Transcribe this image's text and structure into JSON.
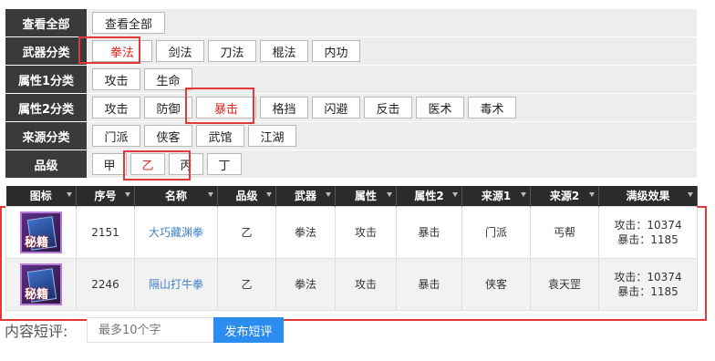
{
  "filters": [
    {
      "label": "查看全部",
      "options": [
        "查看全部"
      ],
      "active": -1
    },
    {
      "label": "武器分类",
      "options": [
        "拳法",
        "剑法",
        "刀法",
        "棍法",
        "内功"
      ],
      "active": 0
    },
    {
      "label": "属性1分类",
      "options": [
        "攻击",
        "生命"
      ],
      "active": -1
    },
    {
      "label": "属性2分类",
      "options": [
        "攻击",
        "防御",
        "暴击",
        "格挡",
        "闪避",
        "反击",
        "医术",
        "毒术"
      ],
      "active": 2
    },
    {
      "label": "来源分类",
      "options": [
        "门派",
        "侠客",
        "武馆",
        "江湖"
      ],
      "active": -1
    },
    {
      "label": "品级",
      "options": [
        "甲",
        "乙",
        "丙",
        "丁"
      ],
      "active": 1
    }
  ],
  "table": {
    "headers": [
      "图标",
      "序号",
      "名称",
      "品级",
      "武器",
      "属性",
      "属性2",
      "来源1",
      "来源2",
      "满级效果"
    ],
    "rows": [
      {
        "icon": "秘籍",
        "id": "2151",
        "name": "大巧藏渊拳",
        "grade": "乙",
        "weapon": "拳法",
        "attr1": "攻击",
        "attr2": "暴击",
        "source1": "门派",
        "source2": "丐帮",
        "effect1": "攻击：10374",
        "effect2": "暴击：1185"
      },
      {
        "icon": "秘籍",
        "id": "2246",
        "name": "隔山打牛拳",
        "grade": "乙",
        "weapon": "拳法",
        "attr1": "攻击",
        "attr2": "暴击",
        "source1": "侠客",
        "source2": "袁天罡",
        "effect1": "攻击：10374",
        "effect2": "暴击：1185"
      }
    ]
  },
  "review": {
    "label": "内容短评:",
    "placeholder": "最多10个字",
    "button": "发布短评"
  },
  "colors": {
    "active_text": "#e0261f",
    "highlight": "#e23a3a",
    "link": "#3f7fc6",
    "button": "#2d8cf0"
  }
}
